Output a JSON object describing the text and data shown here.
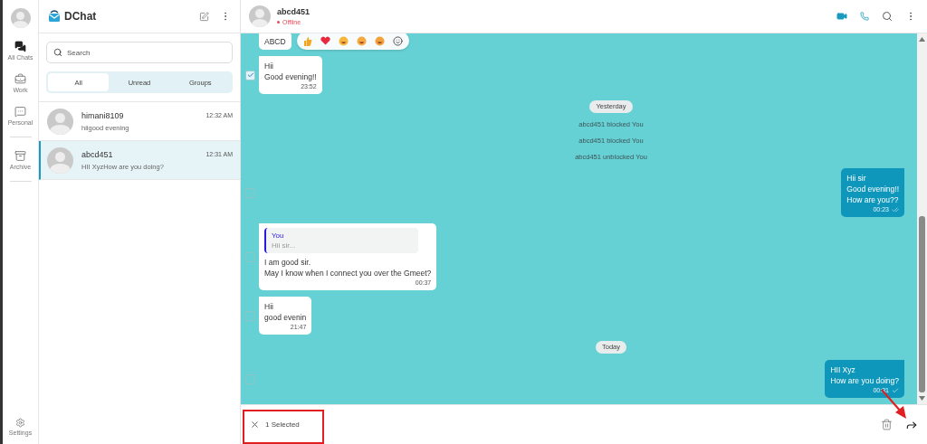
{
  "rail": {
    "items": [
      {
        "kind": "chats",
        "label": "All Chats",
        "selected": true
      },
      {
        "kind": "work",
        "label": "Work",
        "selected": false
      },
      {
        "kind": "personal",
        "label": "Personal",
        "selected": false
      },
      {
        "kind": "archive",
        "label": "Archive",
        "selected": false
      }
    ],
    "settings": "Settings"
  },
  "app": {
    "name": "DChat"
  },
  "search": {
    "placeholder": "Search"
  },
  "filters": [
    {
      "label": "All",
      "selected": true
    },
    {
      "label": "Unread",
      "selected": false
    },
    {
      "label": "Groups",
      "selected": false
    }
  ],
  "conversations": [
    {
      "name": "himani8109",
      "preview": "hiigood evening",
      "time": "12:32 AM",
      "selected": false
    },
    {
      "name": "abcd451",
      "preview": "HII XyzHow are you doing?",
      "time": "12:31 AM",
      "selected": true
    }
  ],
  "chat": {
    "name": "abcd451",
    "status": "Offline"
  },
  "messages": [
    {
      "kind": "received",
      "lines": [
        "ABCD"
      ]
    },
    {
      "kind": "received",
      "lines": [
        "Hii",
        "Good evening!!"
      ],
      "time": "23:52",
      "selected": true
    },
    {
      "kind": "date",
      "text": "Yesterday"
    },
    {
      "kind": "event",
      "text": "abcd451 blocked You"
    },
    {
      "kind": "event",
      "text": "abcd451 blocked You"
    },
    {
      "kind": "event",
      "text": "abcd451 unblocked You"
    },
    {
      "kind": "sent",
      "lines": [
        "Hii sir",
        "Good evening!!",
        "How are you??"
      ],
      "time": "00:23",
      "read": true,
      "selected": false
    },
    {
      "kind": "received",
      "reply": {
        "author": "You",
        "text": "Hii sir..."
      },
      "lines": [
        "I am good sir.",
        "May I know when I connect you over the Gmeet?"
      ],
      "time": "00:37",
      "selected": false
    },
    {
      "kind": "received",
      "lines": [
        "Hii",
        "good evenin"
      ],
      "time": "21:47",
      "selected": false
    },
    {
      "kind": "date",
      "text": "Today"
    },
    {
      "kind": "sent",
      "lines": [
        "HII Xyz",
        "How are you doing?"
      ],
      "time": "00:31",
      "read": false,
      "selected": false
    }
  ],
  "selection": {
    "label": "1 Selected"
  }
}
